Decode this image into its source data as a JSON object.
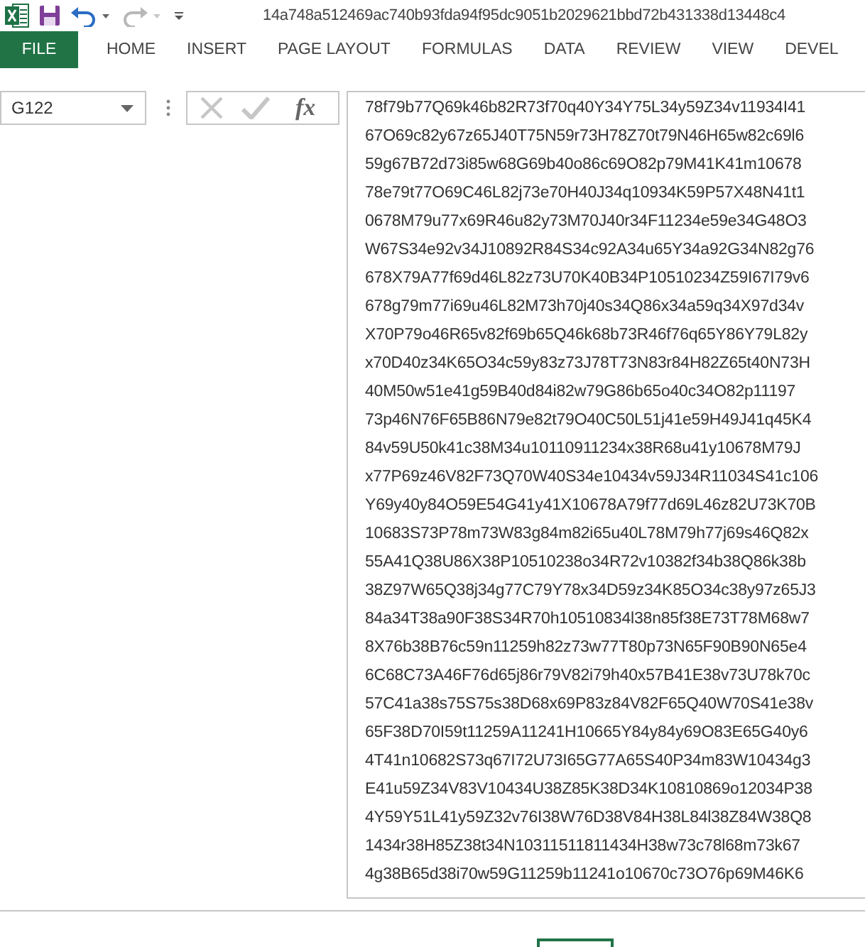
{
  "quick_access": {
    "undo": {
      "disabled": false
    },
    "redo": {
      "disabled": true
    }
  },
  "window": {
    "title": "14a748a512469ac740b93fda94f95dc9051b2029621bbd72b431338d13448c4"
  },
  "ribbon_tabs": [
    {
      "label": "FILE",
      "kind": "file"
    },
    {
      "label": "HOME",
      "kind": "tab"
    },
    {
      "label": "INSERT",
      "kind": "tab"
    },
    {
      "label": "PAGE LAYOUT",
      "kind": "tab"
    },
    {
      "label": "FORMULAS",
      "kind": "tab"
    },
    {
      "label": "DATA",
      "kind": "tab"
    },
    {
      "label": "REVIEW",
      "kind": "tab"
    },
    {
      "label": "VIEW",
      "kind": "tab"
    },
    {
      "label": "DEVEL",
      "kind": "tab"
    }
  ],
  "name_box": {
    "value": "G122"
  },
  "formula_bar": {
    "function_label": "fx",
    "lines": [
      "78f79b77Q69k46b82R73f70q40Y34Y75L34y59Z34v11934I41",
      "67O69c82y67z65J40T75N59r73H78Z70t79N46H65w82c69l6",
      "59g67B72d73i85w68G69b40o86c69O82p79M41K41m10678",
      "78e79t77O69C46L82j73e70H40J34q10934K59P57X48N41t1",
      "0678M79u77x69R46u82y73M70J40r34F11234e59e34G48O3",
      "W67S34e92v34J10892R84S34c92A34u65Y34a92G34N82g76",
      "678X79A77f69d46L82z73U70K40B34P10510234Z59I67I79v6",
      "678g79m77i69u46L82M73h70j40s34Q86x34a59q34X97d34v",
      "X70P79o46R65v82f69b65Q46k68b73R46f76q65Y86Y79L82y",
      "x70D40z34K65O34c59y83z73J78T73N83r84H82Z65t40N73H",
      "40M50w51e41g59B40d84i82w79G86b65o40c34O82p11197",
      "73p46N76F65B86N79e82t79O40C50L51j41e59H49J41q45K4",
      "84v59U50k41c38M34u10110911234x38R68u41y10678M79J",
      "x77P69z46V82F73Q70W40S34e10434v59J34R11034S41c106",
      "Y69y40y84O59E54G41y41X10678A79f77d69L46z82U73K70B",
      "10683S73P78m73W83g84m82i65u40L78M79h77j69s46Q82x",
      "55A41Q38U86X38P10510238o34R72v10382f34b38Q86k38b",
      "38Z97W65Q38j34g77C79Y78x34D59z34K85O34c38y97z65J3",
      "84a34T38a90F38S34R70h10510834l38n85f38E73T78M68w7",
      "8X76b38B76c59n11259h82z73w77T80p73N65F90B90N65e4",
      "6C68C73A46F76d65j86r79V82i79h40x57B41E38v73U78k70c",
      "57C41a38s75S75s38D68x69P83z84V82F65Q40W70S41e38v",
      "65F38D70I59t11259A11241H10665Y84y84y69O83E65G40y6",
      "4T41n10682S73q67I72U73I65G77A65S40P34m83W10434g3",
      "E41u59Z34V83V10434U38Z85K38D34K10810869o12034P38",
      "4Y59Y51L41y59Z32v76I38W76D38V84H38L84l38Z84W38Q8",
      "1434r38H85Z38t34N10311511811434H38w73c78l68m73k67",
      "4g38B65d38i70w59G11259b11241o10670c73O76p69M46K6"
    ]
  }
}
